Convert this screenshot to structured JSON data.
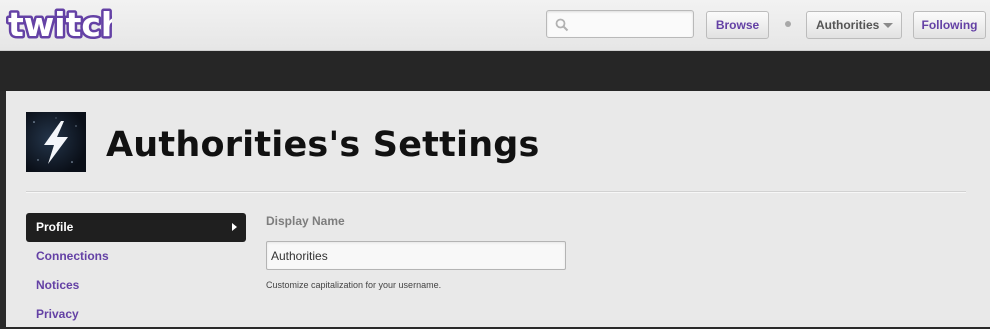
{
  "header": {
    "logo_text": "twitch",
    "search": {
      "value": "",
      "placeholder": ""
    },
    "browse_label": "Browse",
    "user_menu_label": "Authorities",
    "following_label": "Following"
  },
  "settings": {
    "title": "Authorities's Settings",
    "nav": [
      {
        "label": "Profile",
        "active": true
      },
      {
        "label": "Connections",
        "active": false
      },
      {
        "label": "Notices",
        "active": false
      },
      {
        "label": "Privacy",
        "active": false
      }
    ],
    "display_name": {
      "label": "Display Name",
      "value": "Authorities",
      "hint": "Customize capitalization for your username."
    }
  },
  "colors": {
    "brand": "#6441a5",
    "active_nav": "#1f1f1f",
    "dark_band": "#262626"
  }
}
